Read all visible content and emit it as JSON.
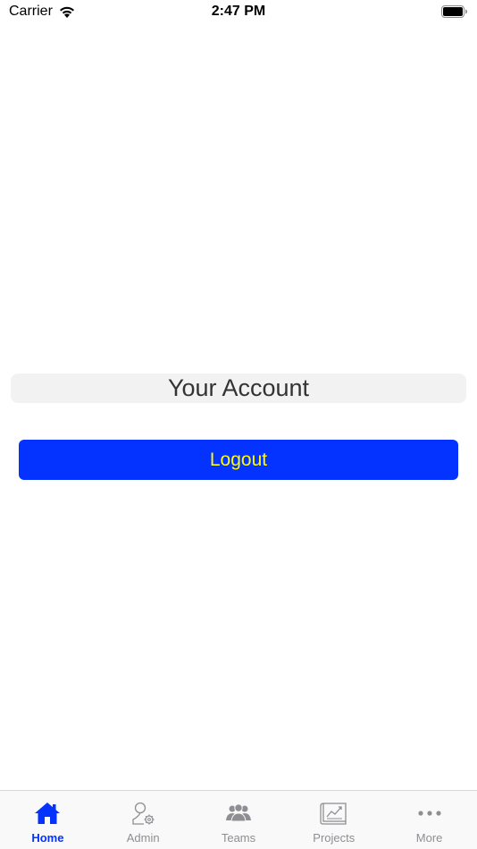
{
  "status_bar": {
    "carrier": "Carrier",
    "time": "2:47 PM"
  },
  "main": {
    "account_title": "Your Account",
    "logout_label": "Logout"
  },
  "tab_bar": {
    "active_color": "#0433ff",
    "inactive_color": "#8e8e93",
    "items": [
      {
        "label": "Home",
        "icon": "home-icon",
        "active": true
      },
      {
        "label": "Admin",
        "icon": "admin-user-gear-icon",
        "active": false
      },
      {
        "label": "Teams",
        "icon": "teams-group-icon",
        "active": false
      },
      {
        "label": "Projects",
        "icon": "projects-chart-icon",
        "active": false
      },
      {
        "label": "More",
        "icon": "more-ellipsis-icon",
        "active": false
      }
    ]
  },
  "colors": {
    "logout_button_bg": "#0433ff",
    "logout_button_text": "#fffb00",
    "account_label_bg": "#f2f2f2"
  }
}
